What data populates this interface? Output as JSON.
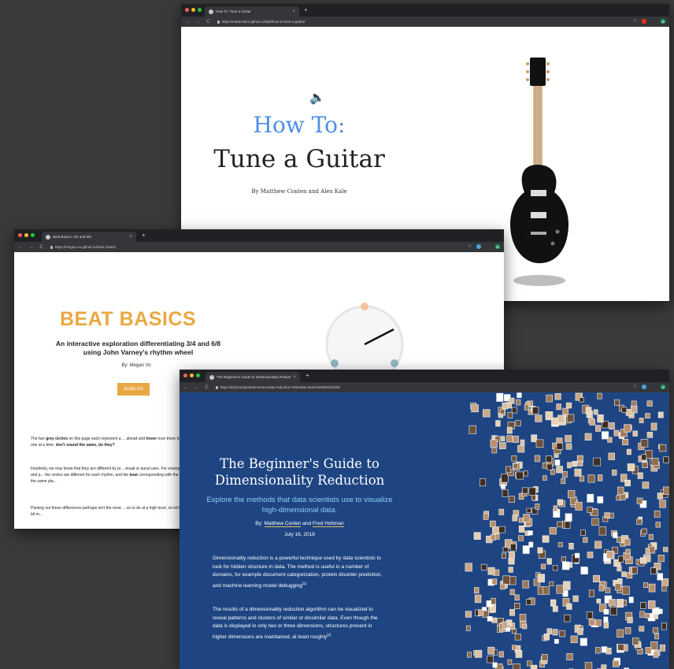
{
  "guitar_window": {
    "tab_title": "How To: Tune a Guitar",
    "url": "https://mattconlen.github.io/idyll/how-to-tune-a-guitar/",
    "ext_label": "M",
    "heading_line1": "How To:",
    "heading_line2": "Tune a Guitar",
    "byline": "By Matthew Conlen and Alex Kale"
  },
  "beat_window": {
    "tab_title": "Beat Basics: 3/4 and 6/8",
    "url": "https://megan-vo.github.io/basic-beats/",
    "ext_label": "M",
    "title": "BEAT BASICS",
    "subtitle": "An interactive exploration differentiating 3/4 and 6/8 using John Varney's rhythm wheel",
    "byline": "By: Megan Vo",
    "audio_button": "Audio On",
    "para1_start": "The two ",
    "para1_bold1": "grey circles",
    "para1_mid": " on this page each represent a ... ahead and ",
    "para1_bold2": "hover",
    "para1_end": " over there to play a rhythm one at a time.",
    "para1_bold3": "don't sound the same, do they?",
    "para2_a": "Intuitively, we may know that they are different by pi... visual or aural cues. For example, the ",
    "para2_bold1": "number",
    "para2_b": " and p... the circles are different for each rhythm, and the ",
    "para2_bold2": "beat",
    "para2_c": " corresponding with the circles aren't at the same pla...",
    "para3": "Parsing out these differences perhaps isn't the most ... us to do at a high level, so let's break it down a bit m..."
  },
  "dr_window": {
    "tab_title": "The Beginner's Guide to Dimensionality Reduction",
    "url": "https://idyll.pub/post/dimensionality-reduction-293e465c2a3443e8941b016d/",
    "ext_label": "M",
    "title": "The Beginner's Guide to Dimensionality Reduction",
    "subtitle": "Explore the methods that data scientists use to visualize high-dimensional data.",
    "by_prefix": "By: ",
    "author1": "Matthew Conlen",
    "by_and": " and ",
    "author2": "Fred Hohman",
    "date": "July 16, 2018",
    "para1": "Dimensionality reduction is a powerful technique used by data scientists to look for hidden structure in data. The method is useful in a number of domains, for example document categorization, protein disorder prediction, and machine learning model debugging",
    "para1_ref": "[1]",
    "para2": "The results of a dimensionality reduction algorithm can be visualized to reveal patterns and clusters of similar or dissimilar data. Even though the data is displayed in only two or three dimensions, structures present in higher dimensions are maintained, at least roughly",
    "para2_ref": "[2]"
  },
  "colors": {
    "desktop": "#3a3a3a",
    "how_blue": "#4a8fe7",
    "beat_orange": "#eaa843",
    "dr_blue": "#1e4582",
    "dr_subtitle": "#8fd0f5"
  }
}
